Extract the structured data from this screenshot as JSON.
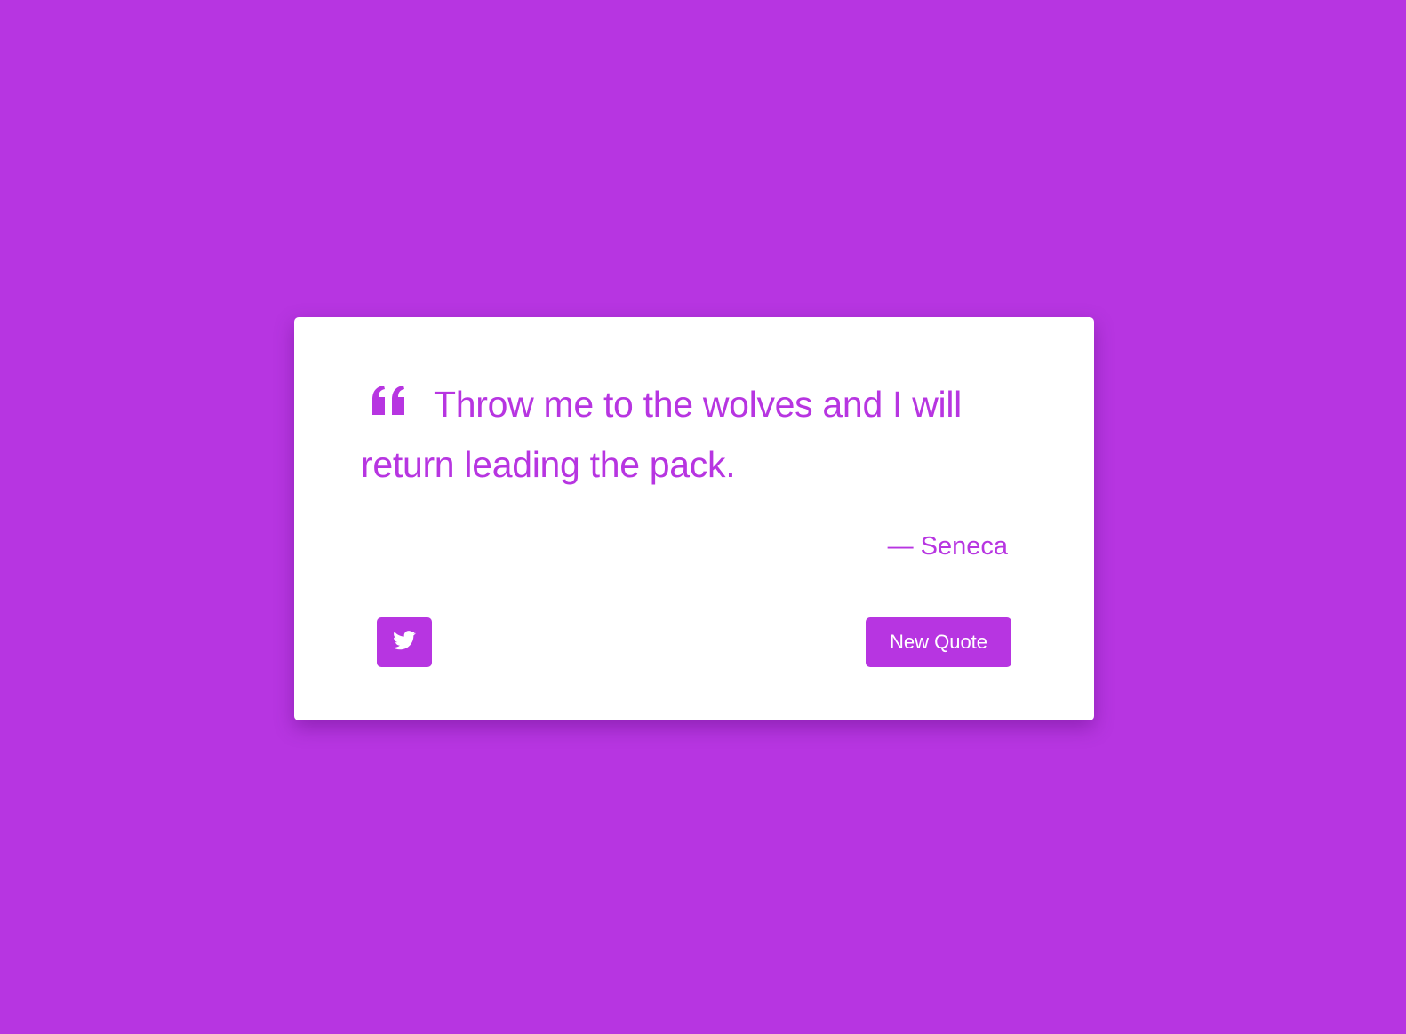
{
  "theme": {
    "background_color": "#b735e1",
    "card_color": "#ffffff",
    "accent_color": "#b735e1"
  },
  "quote": {
    "icon": "quote-left-icon",
    "text": "Throw me to the wolves and I will return leading the pack.",
    "author_dash": "—",
    "author": "Seneca"
  },
  "actions": {
    "tweet_icon": "twitter-icon",
    "new_quote_label": "New Quote"
  }
}
